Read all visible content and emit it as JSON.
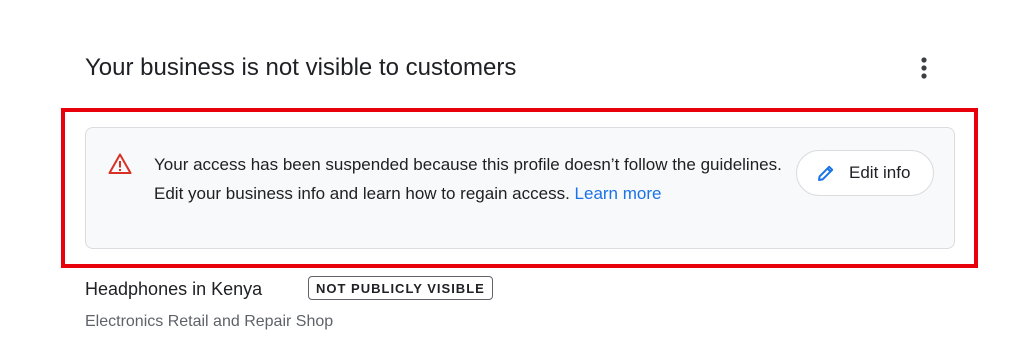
{
  "header": {
    "title": "Your business is not visible to customers",
    "more_icon": "more-vert-icon"
  },
  "alert": {
    "icon": "warning-triangle-icon",
    "icon_color": "#d93025",
    "message": "Your access has been suspended because this profile doesn’t follow the guidelines. Edit your business info and learn how to regain access.",
    "link_label": "Learn more",
    "edit_button_label": "Edit info",
    "edit_button_icon": "pencil-icon",
    "highlight_color": "#e8000b"
  },
  "business": {
    "name": "Headphones in Kenya",
    "status_badge": "NOT PUBLICLY VISIBLE",
    "category": "Electronics Retail and Repair Shop"
  }
}
